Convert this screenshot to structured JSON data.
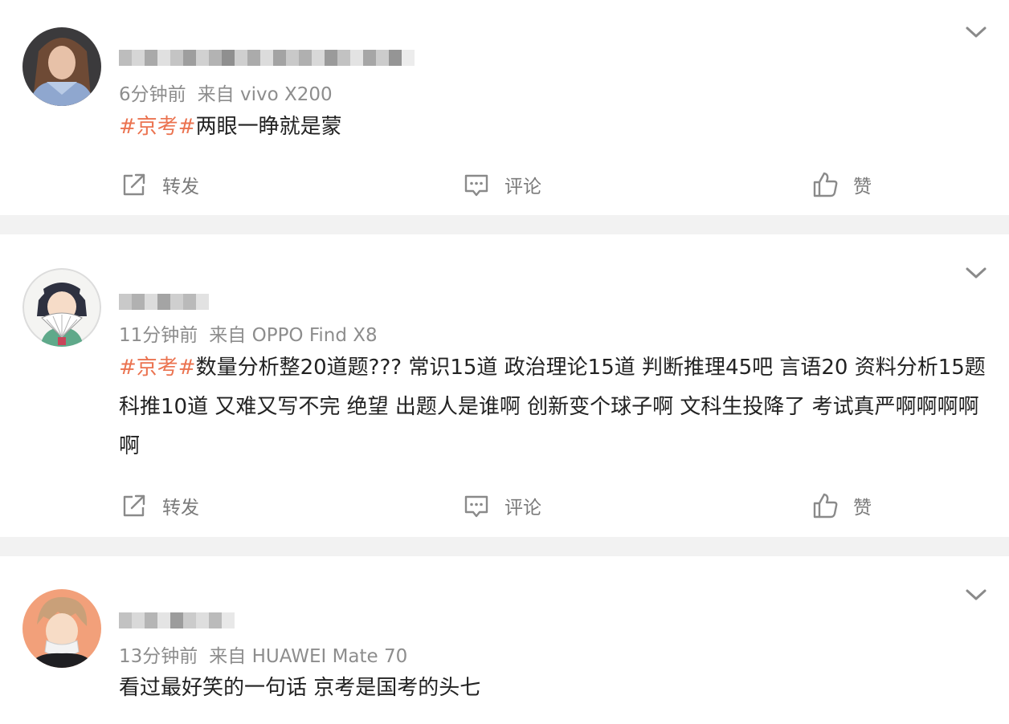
{
  "posts": [
    {
      "meta_time": "6分钟前",
      "meta_source": "来自 vivo X200",
      "content_tag": "#京考#",
      "content_text": "两眼一睁就是蒙",
      "actions": {
        "repost": "转发",
        "comment": "评论",
        "like": "赞"
      }
    },
    {
      "meta_time": "11分钟前",
      "meta_source": "来自 OPPO Find X8",
      "content_tag": "#京考#",
      "content_text": "数量分析整20道题??? 常识15道 政治理论15道 判断推理45吧 言语20 资料分析15题 科推10道 又难又写不完 绝望 出题人是谁啊 创新变个球子啊 文科生投降了 考试真严啊啊啊啊啊",
      "actions": {
        "repost": "转发",
        "comment": "评论",
        "like": "赞"
      }
    },
    {
      "meta_time": "13分钟前",
      "meta_source": "来自 HUAWEI Mate 70",
      "content_tag": "",
      "content_text": "看过最好笑的一句话 京考是国考的头七"
    }
  ],
  "colors": {
    "hashtag": "#eb7350",
    "meta": "#8d8d8d",
    "text": "#222222",
    "divider": "#f2f2f2"
  },
  "icons": [
    "chevron-down-icon",
    "repost-icon",
    "comment-icon",
    "thumbs-up-icon"
  ]
}
